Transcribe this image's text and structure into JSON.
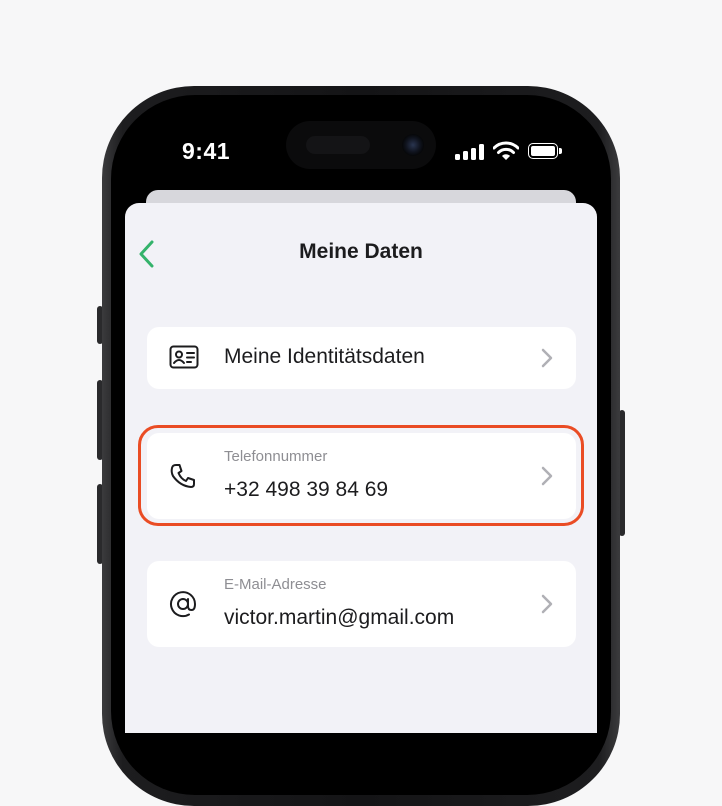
{
  "status_bar": {
    "time": "9:41",
    "icons": [
      "cellular-signal-icon",
      "wifi-icon",
      "battery-icon"
    ]
  },
  "nav": {
    "back_icon": "chevron-left-icon",
    "title": "Meine Daten"
  },
  "rows": [
    {
      "icon": "id-card-icon",
      "primary": "Meine Identitätsdaten"
    },
    {
      "icon": "phone-icon",
      "caption": "Telefonnummer",
      "primary": "+32 498 39 84 69",
      "highlighted": true
    },
    {
      "icon": "at-sign-icon",
      "caption": "E-Mail-Adresse",
      "primary": "victor.martin@gmail.com"
    }
  ],
  "colors": {
    "accent": "#34b36b",
    "highlight": "#ea4c24",
    "background": "#f2f2f7"
  }
}
